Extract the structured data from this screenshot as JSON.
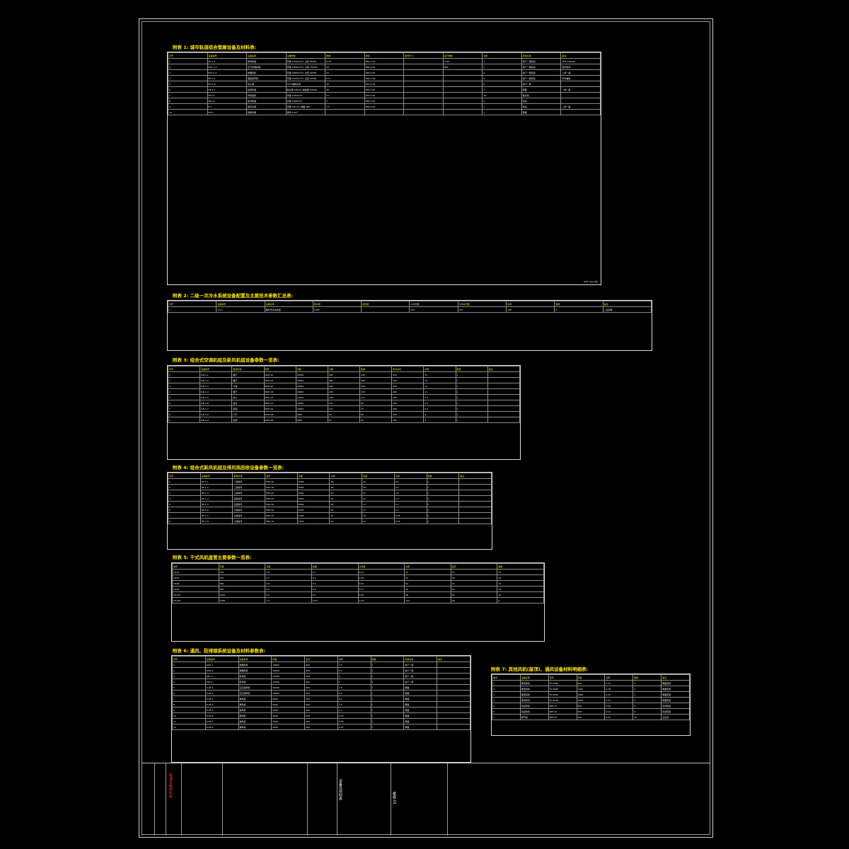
{
  "sheet": {
    "appendix1_title": "附表 1: 城市轨道综合管廊设备及材料表:",
    "appendix1_head": [
      "序号",
      "设备编号",
      "设备名称",
      "主要参数",
      "数量",
      "单位",
      "型号尺寸",
      "运行重量",
      "功率",
      "安装位置",
      "备注"
    ],
    "appendix1_units": [
      "(kW)",
      "(kg)",
      "(台)"
    ],
    "appendix1_rows": [
      [
        "1",
        "SF-1-2",
        "排风机组",
        "风量 27000m³/h, 全压 850Pa",
        "63.8",
        "380-3-50",
        "",
        "1120",
        "2",
        "地下一层机房",
        "CFN-1000AF"
      ],
      [
        "2",
        "SAF-1-3",
        "空气处理机组",
        "风量 12000m³/h, 冷量 150kW",
        "23",
        "380-3-50",
        "",
        "600",
        "2",
        "地下一层机房",
        "室外新风"
      ],
      [
        "3",
        "EAF-1-4",
        "排烟风机",
        "风量 18000m³/h, 全压 600Pa",
        "22",
        "380-3-50",
        "",
        "",
        "4",
        "地下一层机房",
        "二用一备"
      ],
      [
        "4",
        "EF-1-5",
        "事故排风机",
        "风量 10000m³/h, 全压 500Pa",
        "5.5",
        "380-3-50",
        "",
        "",
        "4",
        "地下一层机房",
        "平时兼用"
      ],
      [
        "5",
        "FD-1-6",
        "防火阀",
        "70℃熔断关闭",
        "15",
        "220-1-50",
        "",
        "",
        "8",
        "地下一层",
        ""
      ],
      [
        "6",
        "HP-1-7",
        "热泵机组",
        "制冷量 180kW, 制热量 200kW",
        "48",
        "380-3-50",
        "",
        "",
        "2",
        "屋面",
        "一用一备"
      ],
      [
        "7",
        "FCU-1",
        "风机盘管",
        "风量 1020m³/h",
        "0.1",
        "220-1-50",
        "",
        "",
        "36",
        "各房间",
        ""
      ],
      [
        "8",
        "PAU-2",
        "新风机组",
        "风量 3000m³/h",
        "3",
        "380-3-50",
        "",
        "",
        "2",
        "机房",
        ""
      ],
      [
        "9",
        "P-1",
        "循环水泵",
        "流量 50m³/h, 扬程 28m",
        "7.5",
        "380-3-50",
        "",
        "",
        "3",
        "泵房",
        "二用一备"
      ],
      [
        "10",
        "WT-1",
        "膨胀水箱",
        "容积 1.0m³",
        "",
        "",
        "",
        "",
        "1",
        "屋面",
        ""
      ]
    ],
    "appendix2_title": "附表 2: 二级一次冷水系统设备配置及主要技术参数汇总表:",
    "appendix2_head": [
      "序号",
      "设备编号",
      "设备名称",
      "制冷量",
      "制热量",
      "冷水流量",
      "冷却水流量",
      "功率",
      "数量",
      "备注"
    ],
    "appendix2_rows": [
      [
        "1",
        "CH-1",
        "螺杆式冷水机组",
        "1055",
        "",
        "181",
        "227",
        "198",
        "2",
        "二台并联"
      ]
    ],
    "appendix3_title": "附表 3: 组合式空调机组及新风机组设备参数一览表:",
    "appendix3_head": [
      "序号",
      "设备编号",
      "服务区域",
      "型号",
      "风量",
      "冷量",
      "热量",
      "机外余压",
      "功率",
      "数量",
      "备注"
    ],
    "appendix3_rows": [
      [
        "1",
        "K-B-1-1",
        "展厅",
        "MAH-25",
        "25000",
        "280",
        "180",
        "450",
        "15",
        "1",
        ""
      ],
      [
        "2",
        "K-B-1-2",
        "展厅",
        "MAH-25",
        "25000",
        "280",
        "180",
        "450",
        "15",
        "1",
        ""
      ],
      [
        "3",
        "K-B-1-3",
        "大堂",
        "MAH-20",
        "20000",
        "224",
        "150",
        "400",
        "11",
        "1",
        ""
      ],
      [
        "4",
        "K-B-1-4",
        "餐厅",
        "MAH-18",
        "18000",
        "200",
        "130",
        "400",
        "11",
        "1",
        ""
      ],
      [
        "5",
        "K-B-1-5",
        "办公",
        "MAH-15",
        "15000",
        "168",
        "110",
        "350",
        "7.5",
        "1",
        ""
      ],
      [
        "6",
        "K-B-1-6",
        "会议",
        "MAH-12",
        "12000",
        "134",
        "90",
        "350",
        "5.5",
        "1",
        ""
      ],
      [
        "7",
        "K-B-1-7",
        "走廊",
        "MAH-10",
        "10000",
        "112",
        "75",
        "300",
        "5.5",
        "1",
        ""
      ],
      [
        "8",
        "K-B-1-8",
        "门厅",
        "MAH-08",
        "8000",
        "90",
        "60",
        "300",
        "4",
        "1",
        ""
      ],
      [
        "9",
        "K-B-1-9",
        "后勤",
        "MAH-06",
        "6000",
        "67",
        "45",
        "300",
        "3",
        "1",
        ""
      ]
    ],
    "appendix4_title": "附表 4: 组合式新风机组及排风热回收设备参数一览表:",
    "appendix4_head": [
      "序号",
      "设备编号",
      "服务区域",
      "型号",
      "风量",
      "冷量",
      "热量",
      "功率",
      "数量",
      "备注"
    ],
    "appendix4_rows": [
      [
        "1",
        "HF-1-1",
        "一层新风",
        "HRV-30",
        "3000",
        "38",
        "25",
        "2.2",
        "1",
        ""
      ],
      [
        "2",
        "HF-1-2",
        "二层新风",
        "HRV-30",
        "3000",
        "38",
        "25",
        "2.2",
        "1",
        ""
      ],
      [
        "3",
        "HF-1-3",
        "三层新风",
        "HRV-25",
        "2500",
        "32",
        "21",
        "1.5",
        "1",
        ""
      ],
      [
        "4",
        "HF-1-4",
        "四层新风",
        "HRV-25",
        "2500",
        "32",
        "21",
        "1.5",
        "1",
        ""
      ],
      [
        "5",
        "HF-1-5",
        "五层新风",
        "HRV-20",
        "2000",
        "26",
        "17",
        "1.1",
        "1",
        ""
      ],
      [
        "6",
        "HF-1-6",
        "六层新风",
        "HRV-20",
        "2000",
        "26",
        "17",
        "1.1",
        "1",
        ""
      ],
      [
        "7",
        "HF-1-7",
        "七层新风",
        "HRV-15",
        "1500",
        "19",
        "13",
        "0.75",
        "1",
        ""
      ],
      [
        "8",
        "HF-1-8",
        "八层新风",
        "HRV-15",
        "1500",
        "19",
        "13",
        "0.75",
        "1",
        ""
      ]
    ],
    "appendix5_title": "附表 5: 干式风机盘管主要参数一览表:",
    "appendix5_head": [
      "型号",
      "风量",
      "冷量",
      "热量",
      "水流量",
      "功率",
      "噪声",
      "数量"
    ],
    "appendix5_rows": [
      [
        "FP-34",
        "340",
        "1.8",
        "2.7",
        "0.31",
        "37",
        "37",
        "12"
      ],
      [
        "FP-51",
        "510",
        "2.7",
        "4.1",
        "0.46",
        "52",
        "39",
        "18"
      ],
      [
        "FP-68",
        "680",
        "3.6",
        "5.4",
        "0.62",
        "62",
        "41",
        "24"
      ],
      [
        "FP-85",
        "850",
        "4.5",
        "6.8",
        "0.77",
        "76",
        "43",
        "16"
      ],
      [
        "FP-102",
        "1020",
        "5.4",
        "8.1",
        "0.93",
        "96",
        "45",
        "10"
      ],
      [
        "FP-136",
        "1360",
        "7.2",
        "10.8",
        "1.24",
        "134",
        "46",
        "6"
      ]
    ],
    "appendix6_title": "附表 6: 通风、防排烟系统设备及材料参数表:",
    "appendix6_head": [
      "序号",
      "设备编号",
      "设备名称",
      "风量",
      "全压",
      "功率",
      "数量",
      "安装位置",
      "备注"
    ],
    "appendix6_rows": [
      [
        "1",
        "P-B1-1",
        "排烟风机",
        "18000",
        "650",
        "7.5",
        "1",
        "地下一层",
        ""
      ],
      [
        "2",
        "P-B1-2",
        "排烟风机",
        "16000",
        "600",
        "5.5",
        "1",
        "地下一层",
        ""
      ],
      [
        "3",
        "J-B1-1",
        "补风机",
        "12000",
        "450",
        "4",
        "1",
        "地下一层",
        ""
      ],
      [
        "4",
        "J-B1-2",
        "补风机",
        "10000",
        "400",
        "3",
        "1",
        "地下一层",
        ""
      ],
      [
        "5",
        "S-RF-1",
        "正压送风机",
        "20000",
        "600",
        "7.5",
        "1",
        "屋面",
        ""
      ],
      [
        "6",
        "S-RF-2",
        "正压送风机",
        "18000",
        "550",
        "5.5",
        "1",
        "屋面",
        ""
      ],
      [
        "7",
        "E-RF-1",
        "排风机",
        "8000",
        "350",
        "2.2",
        "1",
        "屋面",
        ""
      ],
      [
        "8",
        "E-RF-2",
        "排风机",
        "6000",
        "300",
        "1.5",
        "1",
        "屋面",
        ""
      ],
      [
        "9",
        "E-RF-3",
        "排风机",
        "5000",
        "300",
        "1.1",
        "1",
        "屋面",
        ""
      ],
      [
        "10",
        "E-RF-4",
        "排风机",
        "4000",
        "250",
        "0.75",
        "1",
        "屋面",
        ""
      ],
      [
        "11",
        "E-RF-5",
        "排风机",
        "3000",
        "250",
        "0.55",
        "1",
        "屋面",
        ""
      ],
      [
        "12",
        "E-RF-6",
        "排风机",
        "2000",
        "200",
        "0.37",
        "1",
        "屋面",
        ""
      ]
    ],
    "appendix7_title": "附表 7: 其他风机(屋顶)、通风设备材料明细表:",
    "appendix7_head": [
      "编号",
      "设备名称",
      "型号",
      "风量",
      "功率",
      "数量",
      "备注"
    ],
    "appendix7_rows": [
      [
        "1",
        "屋顶风机",
        "FV-250E",
        "800",
        "0.12",
        "2",
        "屋面安装"
      ],
      [
        "2",
        "屋顶风机",
        "FV-300E",
        "1200",
        "0.18",
        "2",
        "屋面安装"
      ],
      [
        "3",
        "屋顶风机",
        "FV-350E",
        "1800",
        "0.25",
        "2",
        "屋面安装"
      ],
      [
        "4",
        "屋顶风机",
        "FV-400E",
        "2500",
        "0.37",
        "2",
        "屋面安装"
      ],
      [
        "5",
        "管道风机",
        "DPT-15",
        "600",
        "0.09",
        "4",
        "吊顶安装"
      ],
      [
        "6",
        "管道风机",
        "DPT-20",
        "900",
        "0.12",
        "4",
        "吊顶安装"
      ],
      [
        "7",
        "排气扇",
        "BPT-10",
        "200",
        "0.03",
        "12",
        "卫生间"
      ]
    ],
    "title_block": {
      "drawing_name": "暖通设备材料表",
      "project": "设备及材料表",
      "sheet_no": "暖施-01"
    }
  }
}
